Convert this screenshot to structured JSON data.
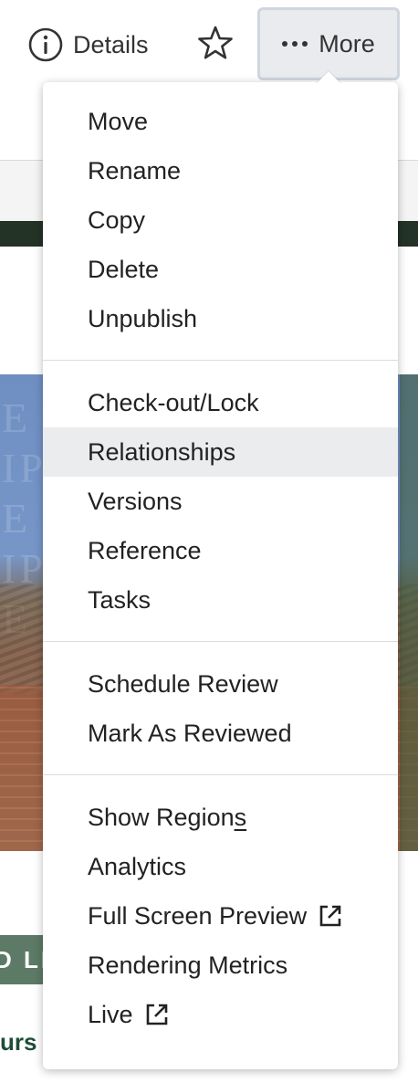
{
  "toolbar": {
    "details_label": "Details",
    "more_label": "More"
  },
  "background": {
    "watermark_lines": [
      "E",
      "IP",
      "E",
      "IP",
      "E"
    ],
    "badge_text": "D LI",
    "link_text": "urs",
    "colors": {
      "dark_band": "#233326",
      "badge": "#5c7a66",
      "link": "#1f4d36"
    }
  },
  "menu": {
    "groups": [
      {
        "items": [
          {
            "label": "Move"
          },
          {
            "label": "Rename"
          },
          {
            "label": "Copy"
          },
          {
            "label": "Delete"
          },
          {
            "label": "Unpublish"
          }
        ]
      },
      {
        "items": [
          {
            "label": "Check-out/Lock"
          },
          {
            "label": "Relationships",
            "highlighted": true
          },
          {
            "label": "Versions"
          },
          {
            "label": "Reference"
          },
          {
            "label": "Tasks"
          }
        ]
      },
      {
        "items": [
          {
            "label": "Schedule Review"
          },
          {
            "label": "Mark As Reviewed"
          }
        ]
      },
      {
        "items": [
          {
            "label_prefix": "Show Region",
            "label_underlined": "s"
          },
          {
            "label": "Analytics"
          },
          {
            "label": "Full Screen Preview",
            "icon": "external-link-icon"
          },
          {
            "label": "Rendering Metrics"
          },
          {
            "label": "Live",
            "icon": "external-link-icon"
          }
        ]
      }
    ],
    "highlight_color": "#ebecee"
  },
  "icons": {
    "details": "info-circle-icon",
    "favorite": "star-outline-icon",
    "more": "ellipsis-icon",
    "external": "external-link-icon"
  }
}
